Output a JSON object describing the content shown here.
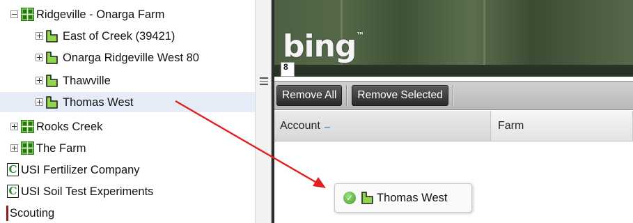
{
  "tree": {
    "farm": {
      "label": "Ridgeville - Onarga Farm"
    },
    "fields": [
      {
        "label": "East of Creek (39421)"
      },
      {
        "label": "Onarga Ridgeville West 80"
      },
      {
        "label": "Thawville"
      },
      {
        "label": "Thomas West"
      }
    ],
    "farms": [
      {
        "label": "Rooks Creek"
      },
      {
        "label": "The Farm"
      }
    ],
    "companies": [
      {
        "label": "USI Fertilizer Company",
        "icon_letter": "C"
      },
      {
        "label": "USI Soil Test Experiments",
        "icon_letter": "C"
      }
    ],
    "scouting": {
      "label": "Scouting"
    }
  },
  "map": {
    "provider_logo": "bing",
    "trademark": "™",
    "scale_text": "8"
  },
  "toolbar": {
    "remove_all_label": "Remove All",
    "remove_selected_label": "Remove Selected"
  },
  "grid": {
    "columns": [
      "Account",
      "Farm"
    ]
  },
  "drag_proxy": {
    "label": "Thomas West",
    "status_glyph": "✓"
  },
  "icons": {
    "farm": "farm-grid-icon",
    "field": "field-flag-icon",
    "company": "company-c-icon",
    "drop_ok": "check-circle-icon",
    "splitter": "grip-icon"
  },
  "colors": {
    "farm_icon_fill": "#6cc24a",
    "field_icon_fill": "#8fd64d",
    "selection": "#e5ecf8",
    "arrow": "#e32020",
    "toolbar_button": "#2f2f2f"
  }
}
